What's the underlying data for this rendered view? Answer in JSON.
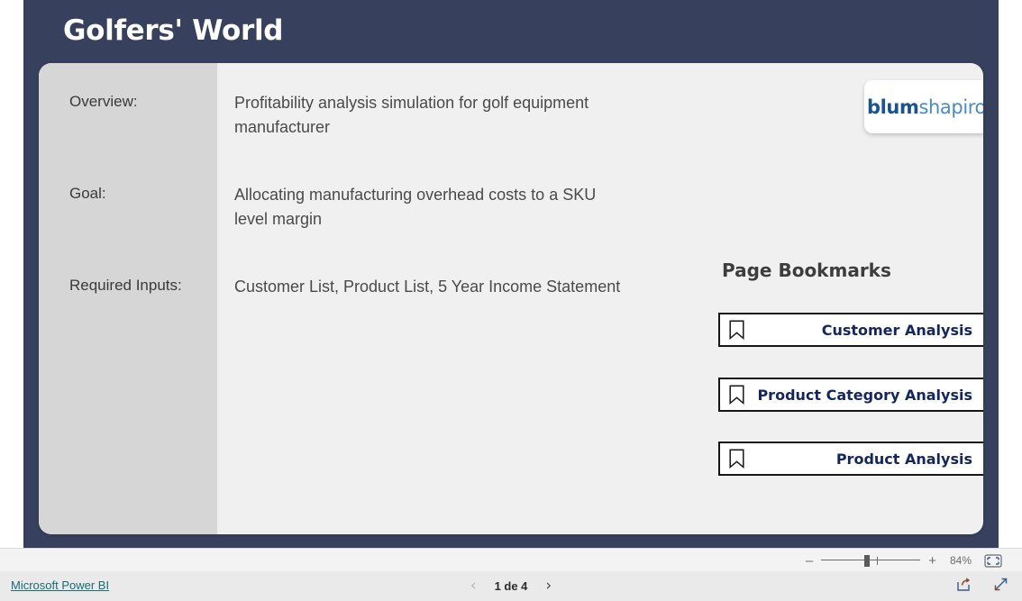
{
  "report": {
    "title": "Golfers' World",
    "accent_navy": "#37405c",
    "panel_grey": "#d6d6d6",
    "card_bg": "#f0f0f0"
  },
  "logo": {
    "name": "blumshapiro",
    "part_bold": "blum",
    "part_light": "shapiro",
    "color_bold": "#1a5490",
    "color_light": "#4a8cc0"
  },
  "info_fields": [
    {
      "label": "Overview:",
      "value": "Profitability analysis simulation for golf equipment manufacturer"
    },
    {
      "label": "Goal:",
      "value": "Allocating manufacturing overhead costs to a SKU level margin"
    },
    {
      "label": "Required Inputs:",
      "value": "Customer List, Product List, 5 Year Income Statement"
    }
  ],
  "bookmarks": {
    "heading": "Page Bookmarks",
    "text_color": "#13265e",
    "items": [
      {
        "label": "Customer Analysis",
        "icon": "bookmark-icon"
      },
      {
        "label": "Product Category Analysis",
        "icon": "bookmark-icon"
      },
      {
        "label": "Product Analysis",
        "icon": "bookmark-icon"
      }
    ]
  },
  "status_bar": {
    "zoom_out_label": "–",
    "zoom_in_label": "+",
    "zoom_value": "84%",
    "fit_to_page_icon": "fit-page-icon"
  },
  "footer": {
    "brand_link": "Microsoft Power BI",
    "brand_link_color": "#1a6b75",
    "prev_page_icon": "‹",
    "next_page_icon": "›",
    "page_label": "1 de 4",
    "share_icon": "share-icon",
    "fullscreen_icon": "fullscreen-icon"
  }
}
